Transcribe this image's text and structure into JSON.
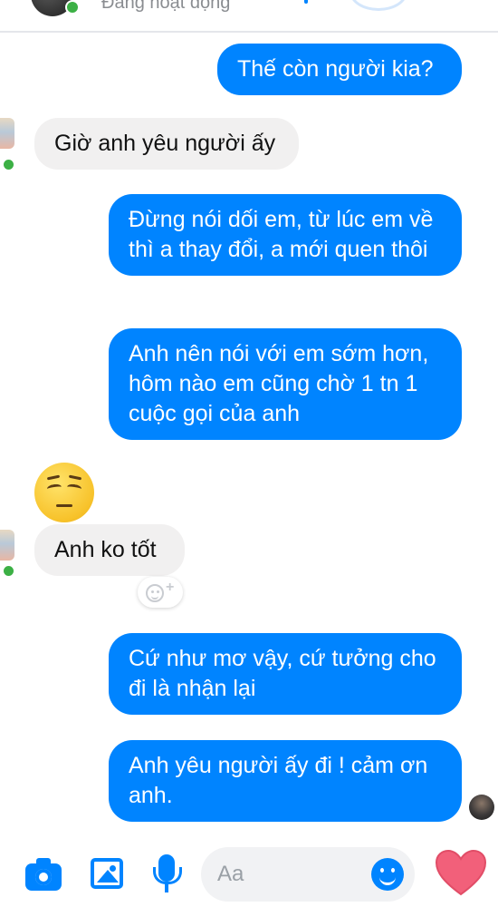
{
  "header": {
    "status": "Đang hoạt động"
  },
  "messages": [
    {
      "direction": "out",
      "text": "Thế còn người kia?"
    },
    {
      "direction": "in",
      "text": "Giờ anh yêu người ấy"
    },
    {
      "direction": "out",
      "text": "Đừng nói dối em, từ lúc em về thì a thay đổi, a mới quen thôi"
    },
    {
      "direction": "out",
      "text": "Anh nên nói với em sớm hơn, hôm nào em cũng chờ 1 tn 1 cuộc gọi của anh"
    },
    {
      "direction": "in",
      "type": "emoji",
      "emoji": "pensive-face"
    },
    {
      "direction": "in",
      "text": "Anh ko tốt"
    },
    {
      "direction": "out",
      "text": "Cứ như mơ vậy, cứ tưởng cho đi là nhận lại"
    },
    {
      "direction": "out",
      "text": "Anh yêu người ấy đi ! cảm ơn anh."
    }
  ],
  "composer": {
    "placeholder": "Aa",
    "icons": [
      "camera-icon",
      "gallery-icon",
      "microphone-icon",
      "emoji-icon",
      "heart-icon"
    ]
  },
  "colors": {
    "outgoing_bubble": "#0084ff",
    "incoming_bubble": "#f1f0f0",
    "accent": "#0084ff",
    "heart": "#f2607a",
    "online": "#3cb045"
  }
}
